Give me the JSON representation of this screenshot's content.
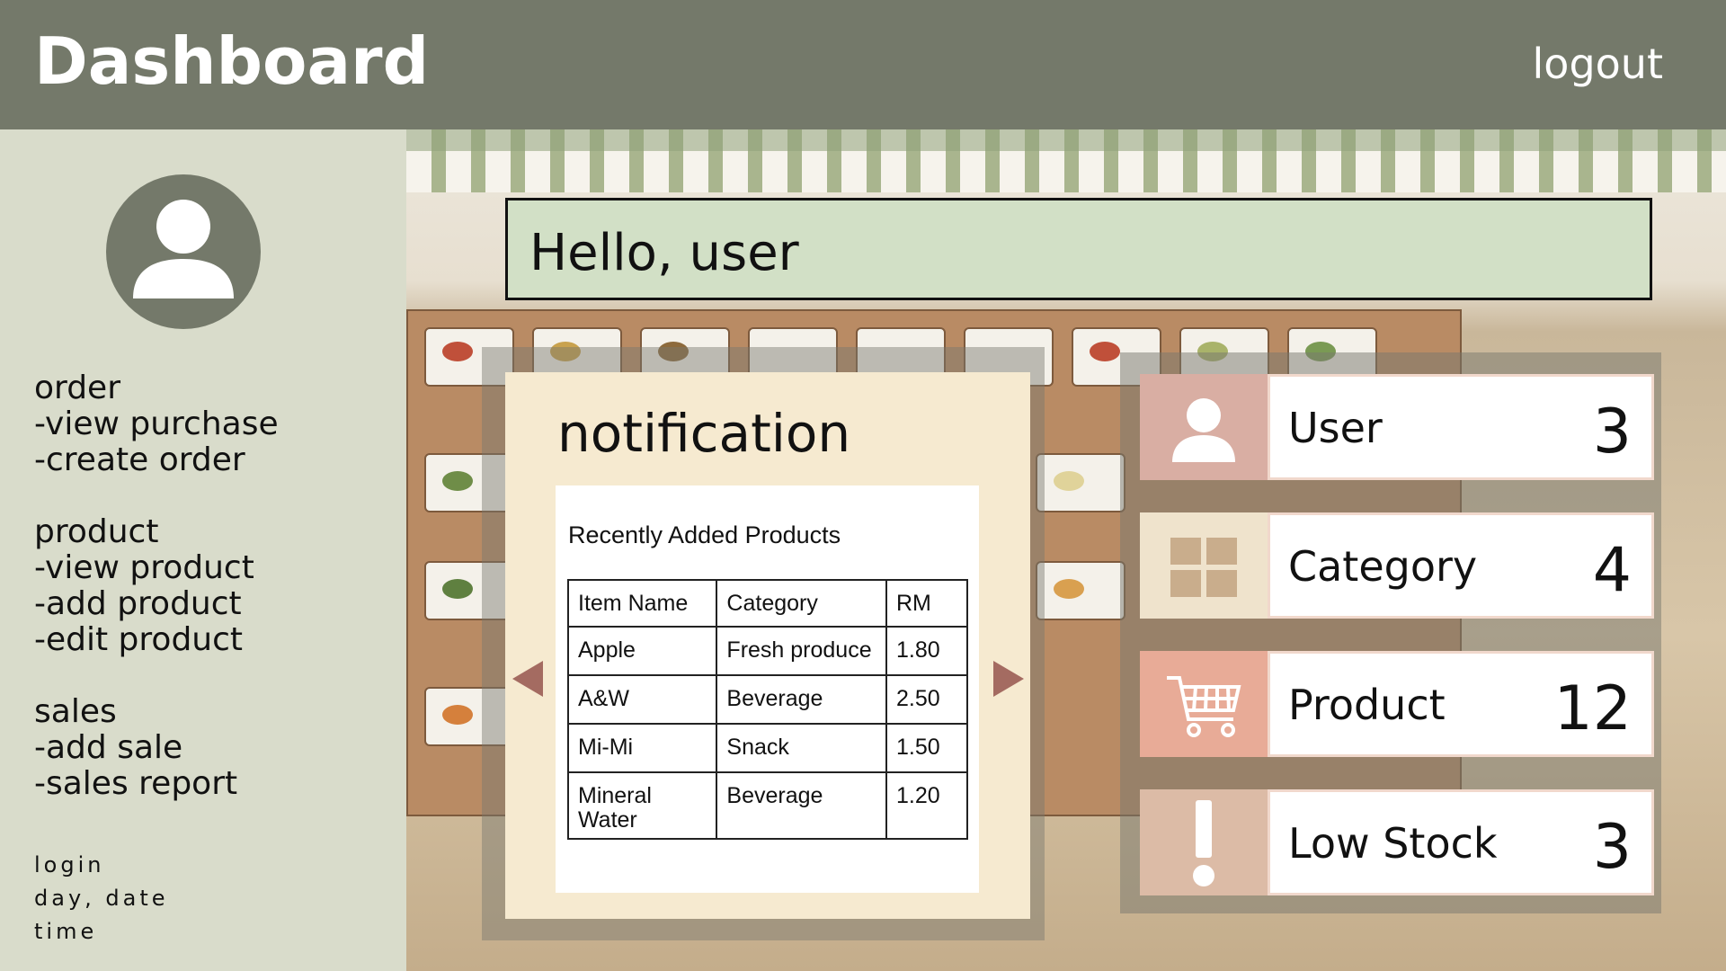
{
  "header": {
    "title": "Dashboard",
    "logout_label": "logout"
  },
  "sidebar": {
    "groups": [
      {
        "title": "order",
        "items": [
          "-view purchase",
          "-create order"
        ]
      },
      {
        "title": "product",
        "items": [
          "-view product",
          "-add product",
          "-edit product"
        ]
      },
      {
        "title": "sales",
        "items": [
          "-add sale",
          "-sales report"
        ]
      }
    ],
    "info": [
      "login",
      "day, date",
      "time"
    ]
  },
  "greeting": "Hello, user",
  "notification": {
    "title": "notification",
    "card_title": "Recently Added Products",
    "columns": [
      "Item Name",
      "Category",
      "RM"
    ],
    "rows": [
      [
        "Apple",
        "Fresh produce",
        "1.80"
      ],
      [
        "A&W",
        "Beverage",
        "2.50"
      ],
      [
        "Mi-Mi",
        "Snack",
        "1.50"
      ],
      [
        "Mineral Water",
        "Beverage",
        "1.20"
      ]
    ]
  },
  "stats": [
    {
      "label": "User",
      "count": "3",
      "icon": "user-icon",
      "color": "#d9aea3"
    },
    {
      "label": "Category",
      "count": "4",
      "icon": "grid-icon",
      "color": "#efe3cc"
    },
    {
      "label": "Product",
      "count": "12",
      "icon": "cart-icon",
      "color": "#e8ab97"
    },
    {
      "label": "Low Stock",
      "count": "3",
      "icon": "exclamation-icon",
      "color": "#dcbba6"
    }
  ],
  "colors": {
    "header": "#74796a",
    "sidebar": "#d9dccb",
    "greeting_bg": "#d2e0c6",
    "notification_bg": "#f6ead0",
    "arrow": "#a46b61"
  }
}
